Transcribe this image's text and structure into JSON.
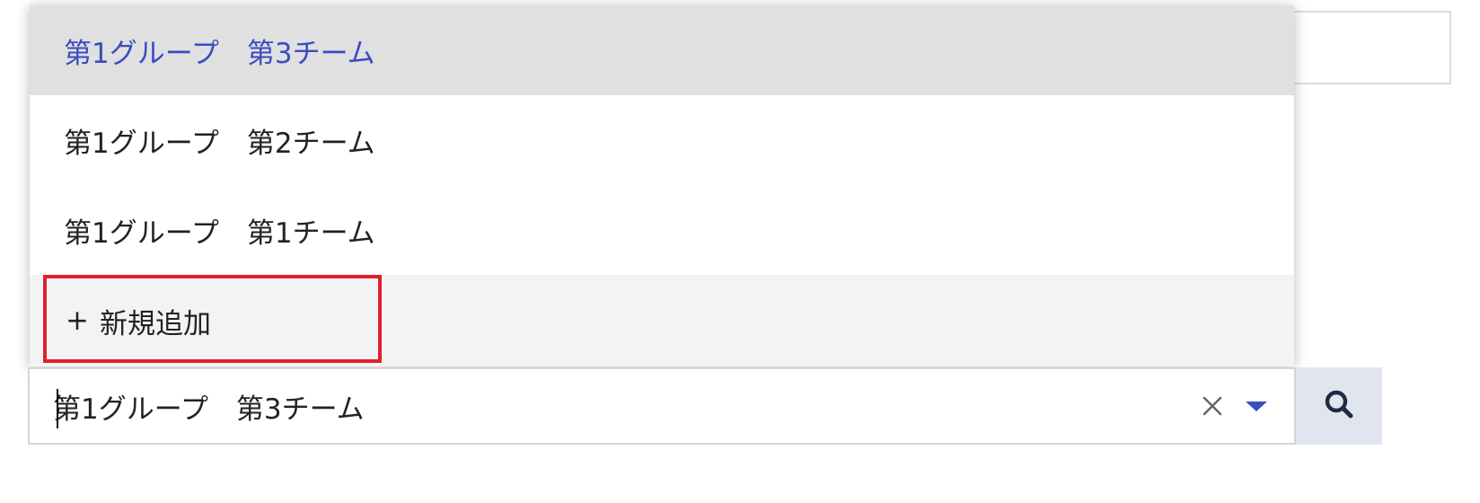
{
  "dropdown": {
    "options": [
      {
        "label": "第1グループ　第3チーム",
        "selected": true
      },
      {
        "label": "第1グループ　第2チーム",
        "selected": false
      },
      {
        "label": "第1グループ　第1チーム",
        "selected": false
      }
    ],
    "add_new": {
      "plus": "+",
      "label": "新規追加"
    }
  },
  "combo": {
    "value": "第1グループ　第3チーム",
    "clear_icon": "close-icon",
    "toggle_icon": "caret-down-icon"
  },
  "search_button": {
    "icon": "search-icon"
  },
  "colors": {
    "selected_text": "#3b4cc0",
    "selected_bg": "#e0e0e0",
    "add_new_bg": "#f3f3f3",
    "highlight_border": "#e0202a",
    "search_button_bg": "#e1e5ee",
    "icon_accent": "#3b4cc0",
    "search_icon": "#1f2a44"
  }
}
